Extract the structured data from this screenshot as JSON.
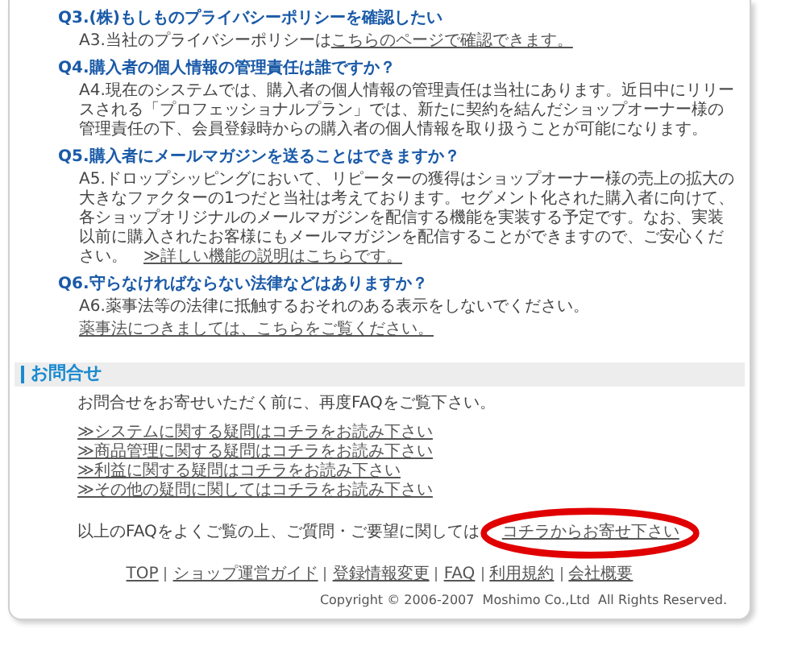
{
  "faq": [
    {
      "question": "Q3.(株)もしものプライバシーポリシーを確認したい",
      "answer": [
        [
          {
            "kind": "text",
            "text": "A3.当社のプライバシーポリシーは"
          },
          {
            "kind": "link",
            "text": "こちらのページで確認できます。"
          }
        ]
      ]
    },
    {
      "question": "Q4.購入者の個人情報の管理責任は誰ですか？",
      "answer": [
        [
          {
            "kind": "text",
            "text": "A4.現在のシステムでは、購入者の個人情報の管理責任は当社にあります。近日中にリリースされる「プロフェッショナルプラン」では、新たに契約を結んだショップオーナー様の管理責任の下、会員登録時からの購入者の個人情報を取り扱うことが可能になります。"
          }
        ]
      ]
    },
    {
      "question": "Q5.購入者にメールマガジンを送ることはできますか？",
      "answer": [
        [
          {
            "kind": "text",
            "text": "A5.ドロップシッピングにおいて、リピーターの獲得はショップオーナー様の売上の拡大の大きなファクターの1つだと当社は考えております。セグメント化された購入者に向けて、各ショップオリジナルのメールマガジンを配信する機能を実装する予定です。なお、実装以前に購入されたお客様にもメールマガジンを配信することができますので、ご安心ください。　"
          },
          {
            "kind": "link",
            "text": "≫詳しい機能の説明はこちらです。"
          }
        ]
      ]
    },
    {
      "question": "Q6.守らなければならない法律などはありますか？",
      "answer": [
        [
          {
            "kind": "text",
            "text": "A6.薬事法等の法律に抵触するおそれのある表示をしないでください。"
          }
        ],
        [
          {
            "kind": "link",
            "text": "薬事法につきましては、こちらをご覧ください。"
          }
        ]
      ]
    }
  ],
  "contact": {
    "title": "お問合せ",
    "intro": "お問合せをお寄せいただく前に、再度FAQをご覧下さい。",
    "links": [
      "≫システムに関する疑問はコチラをお読み下さい",
      "≫商品管理に関する疑問はコチラをお読み下さい",
      "≫利益に関する疑問はコチラをお読み下さい",
      "≫その他の疑問に関してはコチラをお読み下さい"
    ],
    "closing": {
      "text": "以上のFAQをよくご覧の上、ご質問・ご要望に関しては",
      "link": "コチラからお寄せ下さい"
    }
  },
  "annotations": [
    {
      "kind": "ellipse"
    }
  ],
  "footer_nav": [
    "TOP",
    "ショップ運営ガイド",
    "登録情報変更",
    "FAQ",
    "利用規約",
    "会社概要"
  ],
  "copyright": "Copyright © 2006-2007  Moshimo Co.,Ltd  All Rights Reserved."
}
